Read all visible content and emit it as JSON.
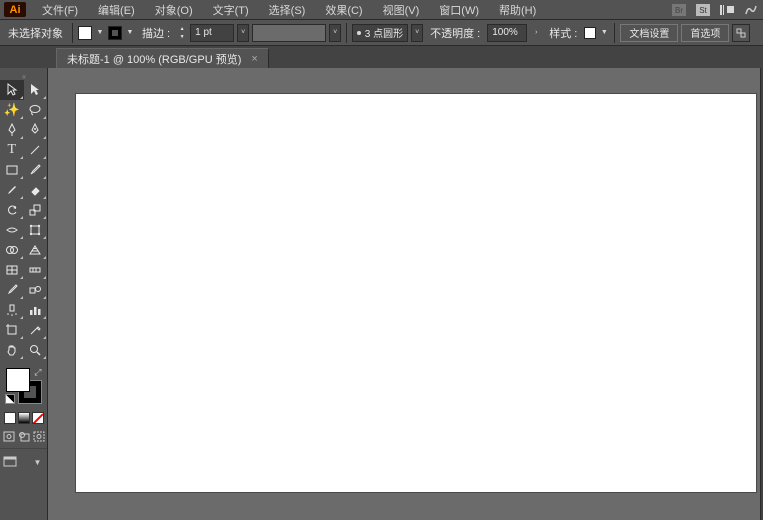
{
  "app_icon": "Ai",
  "menu": {
    "file": "文件(F)",
    "edit": "编辑(E)",
    "object": "对象(O)",
    "type": "文字(T)",
    "select": "选择(S)",
    "effect": "效果(C)",
    "view": "视图(V)",
    "window": "窗口(W)",
    "help": "帮助(H)"
  },
  "controlbar": {
    "no_selection": "未选择对象",
    "stroke_label": "描边 :",
    "stroke_value": "1 pt",
    "brush_label": "3 点圆形",
    "opacity_label": "不透明度 :",
    "opacity_value": "100%",
    "style_label": "样式 :",
    "doc_setup": "文档设置",
    "preferences": "首选项"
  },
  "tab": {
    "title": "未标题-1 @ 100% (RGB/GPU 预览)",
    "close": "×"
  },
  "colors": {
    "fill": "#ffffff",
    "stroke": "#000000",
    "canvas_bg": "#6b6b6b"
  }
}
